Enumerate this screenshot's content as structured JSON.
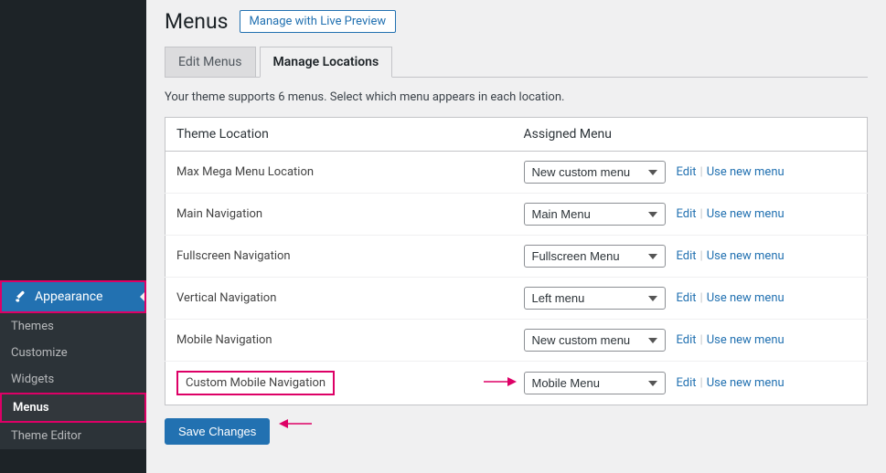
{
  "sidebar": {
    "appearance_label": "Appearance",
    "submenu": [
      {
        "label": "Themes"
      },
      {
        "label": "Customize"
      },
      {
        "label": "Widgets"
      },
      {
        "label": "Menus"
      },
      {
        "label": "Theme Editor"
      }
    ]
  },
  "page": {
    "title": "Menus",
    "live_preview_label": "Manage with Live Preview",
    "tabs": {
      "edit": "Edit Menus",
      "locations": "Manage Locations"
    },
    "description": "Your theme supports 6 menus. Select which menu appears in each location.",
    "col_location": "Theme Location",
    "col_assigned": "Assigned Menu",
    "action_edit": "Edit",
    "action_new": "Use new menu",
    "save_label": "Save Changes"
  },
  "rows": [
    {
      "location": "Max Mega Menu Location",
      "menu": "New custom menu"
    },
    {
      "location": "Main Navigation",
      "menu": "Main Menu"
    },
    {
      "location": "Fullscreen Navigation",
      "menu": "Fullscreen Menu"
    },
    {
      "location": "Vertical Navigation",
      "menu": "Left menu"
    },
    {
      "location": "Mobile Navigation",
      "menu": "New custom menu"
    },
    {
      "location": "Custom Mobile Navigation",
      "menu": "Mobile Menu"
    }
  ]
}
